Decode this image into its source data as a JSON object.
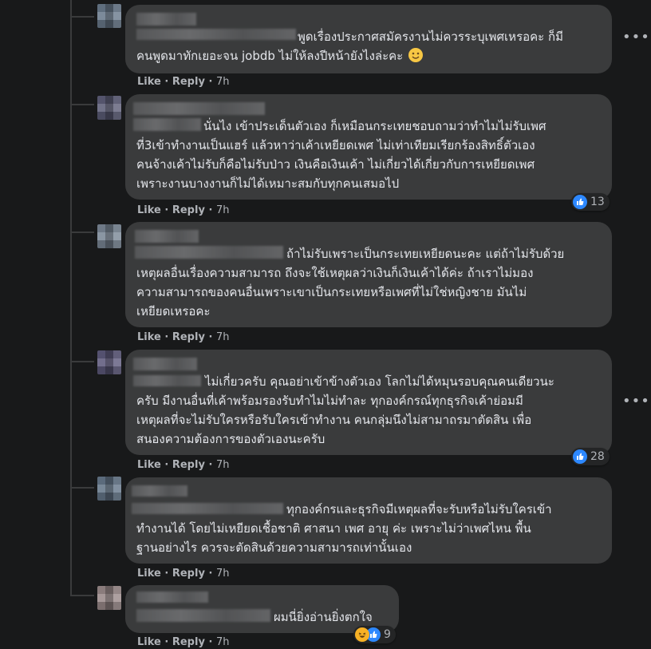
{
  "comments": [
    {
      "lines": [
        "พูดเรื่องประกาศสมัครงานไม่ควรระบุเพศเหรอคะ ก็มี",
        "คนพูดมาทักเยอะจน jobdb ไม่ให้ลงปีหน้ายังไงล่ะคะ"
      ],
      "like": "Like",
      "reply": "Reply",
      "time": "7h",
      "has_emoji": true
    },
    {
      "lines": [
        "นั่นไง เข้าประเด็นตัวเอง ก็เหมือนกระเทยชอบถามว่าทำไมไม่รับเพศ",
        "ที่3เข้าทำงานเป็นแฮร์ แล้วหาว่าเค้าเหยียดเพศ ไม่เท่าเทียมเรียกร้องสิทธิ์ตัวเอง",
        "คนจ้างเค้าไม่รับก็คือไม่รับป่าว เงินคือเงินเค้า ไม่เกี่ยวได้เกี่ยวกับการเหยียดเพศ",
        "เพราะงานบางงานก็ไม่ได้เหมาะสมกับทุกคนเสมอไป"
      ],
      "like": "Like",
      "reply": "Reply",
      "time": "7h",
      "reaction_count": "13"
    },
    {
      "lines": [
        "ถ้าไม่รับเพราะเป็นกระเทยเหยียดนะคะ แต่ถ้าไม่รับด้วย",
        "เหตุผลอื่นเรื่องความสามารถ ถึงจะใช้เหตุผลว่าเงินก็เงินเค้าได้ค่ะ ถ้าเราไม่มอง",
        "ความสามารถของคนอื่นเพราะเขาเป็นกระเทยหรือเพศที่ไม่ใช่หญิงชาย มันไม่",
        "เหยียดเหรอคะ"
      ],
      "like": "Like",
      "reply": "Reply",
      "time": "7h"
    },
    {
      "lines": [
        "ไม่เกี่ยวครับ คุณอย่าเข้าข้างตัวเอง โลกไม่ได้หมุนรอบคุณคนเดียวนะ",
        "ครับ มีงานอื่นที่เค้าพร้อมรองรับทำไมไม่ทำละ ทุกองค์กรณ์ทุกธุรกิจเค้าย่อมมี",
        "เหตุผลที่จะไม่รับใครหรือรับใครเข้าทำงาน คนกลุ่มนึงไม่สามาถรมาตัดสิน เพื่อ",
        "สนองความต้องการของตัวเองนะครับ"
      ],
      "like": "Like",
      "reply": "Reply",
      "time": "7h",
      "reaction_count": "28"
    },
    {
      "lines": [
        "ทุกองค์กรและธุรกิจมีเหตุผลที่จะรับหรือไม่รับใครเข้า",
        "ทำงานได้ โดยไม่เหยียดเชื้อชาติ ศาสนา เพศ อายุ ค่ะ เพราะไม่ว่าเพศไหน พื้น",
        "ฐานอย่างไร ควรจะตัดสินด้วยความสามารถเท่านั้นเอง"
      ],
      "like": "Like",
      "reply": "Reply",
      "time": "7h"
    },
    {
      "lines": [
        "ผมนี่ยิ่งอ่านยิ่งตกใจ"
      ],
      "like": "Like",
      "reply": "Reply",
      "time": "7h",
      "reaction_count": "9"
    }
  ],
  "more_options": "•••",
  "dot": " · "
}
